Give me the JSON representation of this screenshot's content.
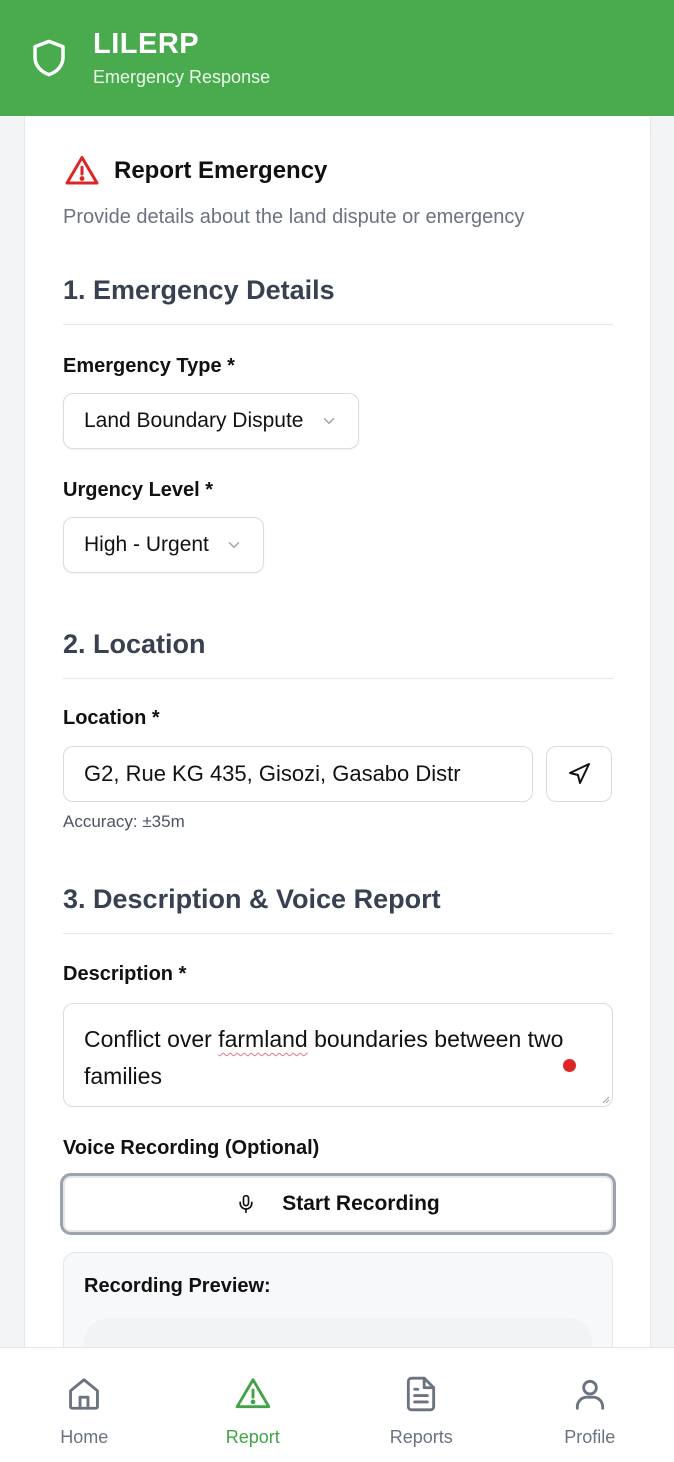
{
  "header": {
    "title": "LILERP",
    "subtitle": "Emergency Response"
  },
  "report": {
    "title": "Report Emergency",
    "subtitle": "Provide details about the land dispute or emergency"
  },
  "sections": {
    "details": "1. Emergency Details",
    "location": "2. Location",
    "description": "3. Description & Voice Report"
  },
  "fields": {
    "emergency_type_label": "Emergency Type *",
    "emergency_type_value": "Land Boundary Dispute",
    "urgency_label": "Urgency Level *",
    "urgency_value": "High - Urgent",
    "location_label": "Location *",
    "location_value": "G2, Rue KG 435, Gisozi, Gasabo Distr",
    "accuracy": "Accuracy: ±35m",
    "description_label": "Description *",
    "description_before": "Conflict over ",
    "description_misspelled": "farmland",
    "description_after": " boundaries between two families",
    "voice_label": "Voice Recording (Optional)",
    "record_button": "Start Recording",
    "preview_title": "Recording Preview:"
  },
  "nav": {
    "items": [
      {
        "label": "Home",
        "icon": "home-icon",
        "active": false
      },
      {
        "label": "Report",
        "icon": "alert-triangle-icon",
        "active": true
      },
      {
        "label": "Reports",
        "icon": "document-icon",
        "active": false
      },
      {
        "label": "Profile",
        "icon": "user-icon",
        "active": false
      }
    ]
  },
  "colors": {
    "brand": "#4aaa4e",
    "active_nav": "#41a345",
    "alert": "#dc2626"
  }
}
